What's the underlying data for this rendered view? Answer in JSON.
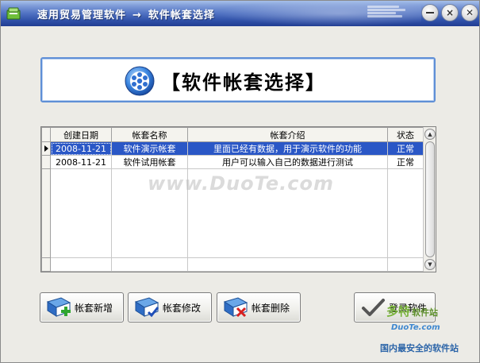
{
  "window": {
    "title_app": "速用贸易管理软件",
    "title_arrow": "→",
    "title_page": "软件帐套选择",
    "controls": {
      "minimize": "",
      "close": "×",
      "maximize": "✕"
    }
  },
  "banner": {
    "text": "【软件帐套选择】",
    "icon": "snowflake-gear-icon"
  },
  "table": {
    "headers": [
      "创建日期",
      "帐套名称",
      "帐套介绍",
      "状态"
    ],
    "rows": [
      {
        "date": "2008-11-21",
        "name": "软件演示帐套",
        "desc": "里面已经有数据，用于演示软件的功能",
        "status": "正常",
        "selected": true
      },
      {
        "date": "2008-11-21",
        "name": "软件试用帐套",
        "desc": "用户可以输入自己的数据进行测试",
        "status": "正常",
        "selected": false
      }
    ],
    "scroll_up": "▲",
    "scroll_down": "▼"
  },
  "watermark": "www.DuoTe.com",
  "buttons": {
    "add": "帐套新增",
    "edit": "帐套修改",
    "delete": "帐套删除",
    "login": "登录软件"
  },
  "brand": {
    "logo": "多特",
    "logo_suffix": "软件站",
    "site": "DuoTe.com",
    "slogan": "国内最安全的软件站"
  },
  "colors": {
    "titlebar": "#2f50a8",
    "selection": "#2a57c6",
    "banner_border": "#5f8fd6",
    "window_bg": "#ecebe6"
  }
}
